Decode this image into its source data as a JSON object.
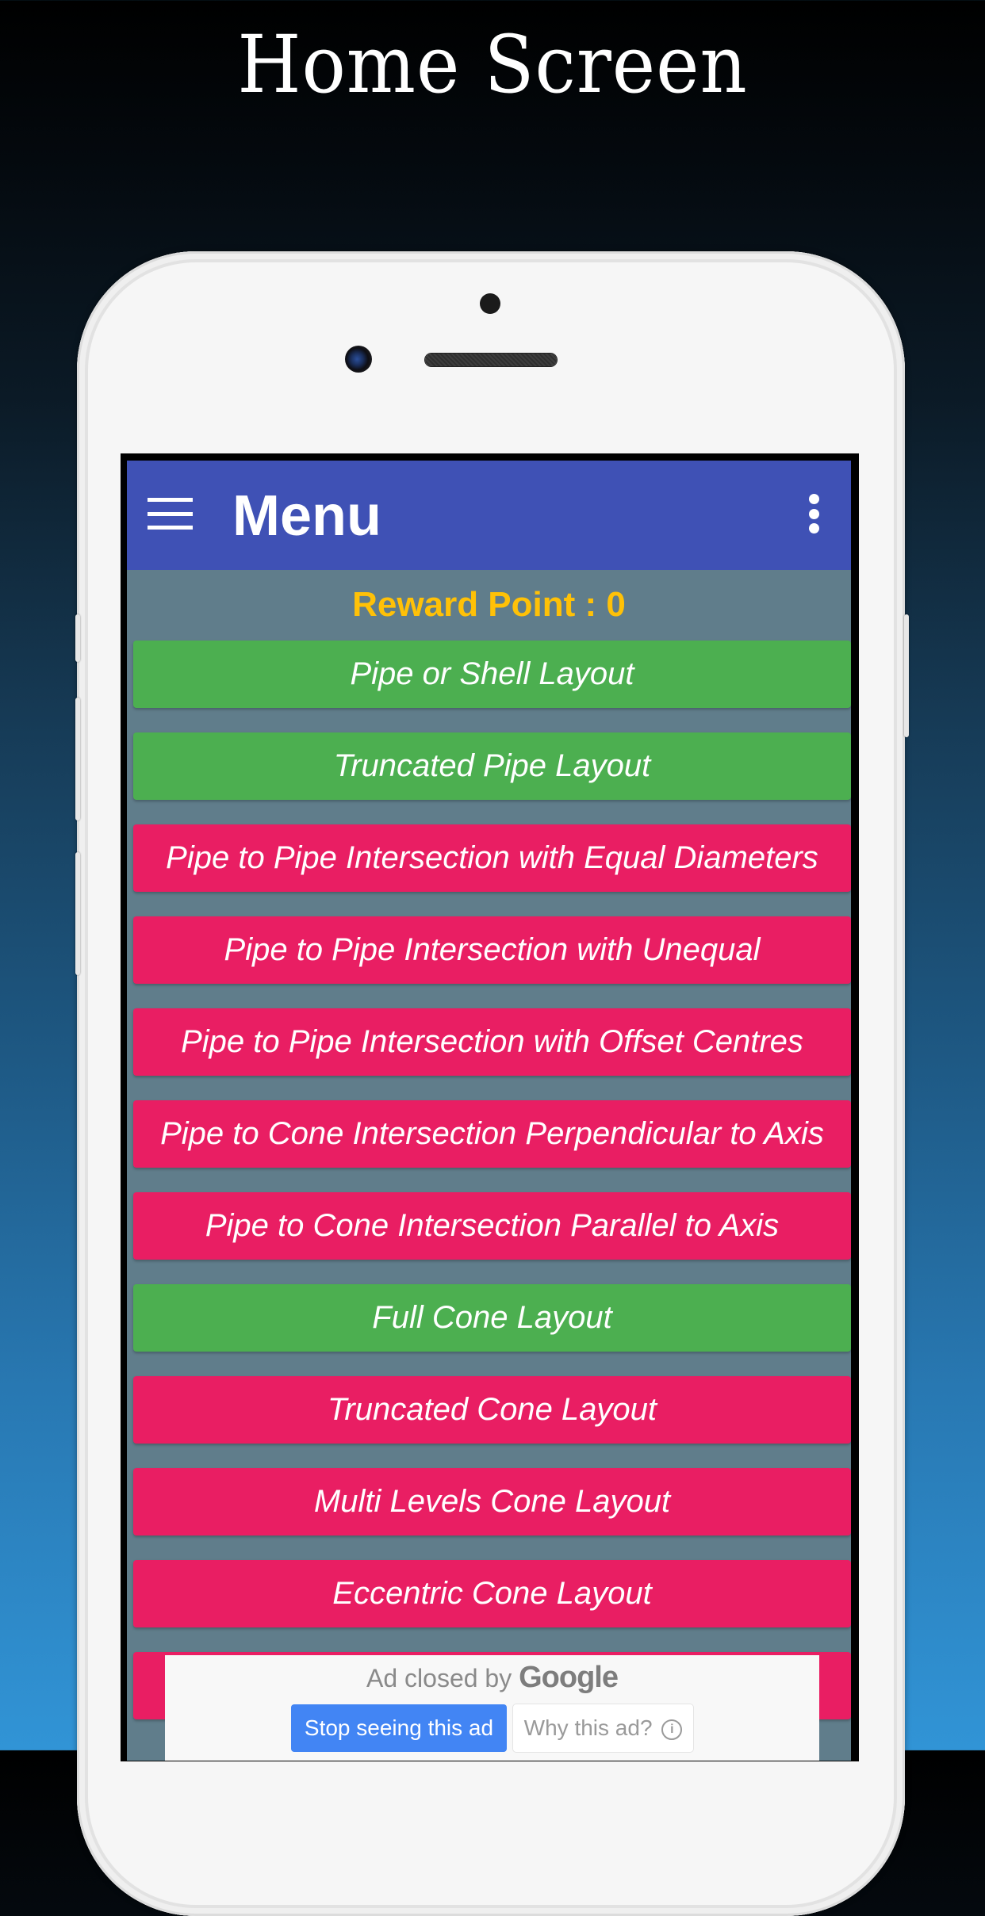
{
  "headline": "Home Screen",
  "app": {
    "toolbar": {
      "title": "Menu",
      "nav_icon": "hamburger-menu-icon",
      "overflow_icon": "more-vertical-icon"
    },
    "reward": "Reward Point : 0",
    "menu_items": [
      {
        "label": "Pipe or Shell Layout",
        "color": "#4caf50"
      },
      {
        "label": "Truncated Pipe Layout",
        "color": "#4caf50"
      },
      {
        "label": "Pipe to Pipe Intersection with Equal Diameters",
        "color": "#e91e63"
      },
      {
        "label": "Pipe to Pipe Intersection with Unequal",
        "color": "#e91e63"
      },
      {
        "label": "Pipe to Pipe Intersection with Offset Centres",
        "color": "#e91e63"
      },
      {
        "label": "Pipe to Cone Intersection Perpendicular to Axis",
        "color": "#e91e63"
      },
      {
        "label": "Pipe to Cone Intersection Parallel to Axis",
        "color": "#e91e63"
      },
      {
        "label": "Full Cone Layout",
        "color": "#4caf50"
      },
      {
        "label": "Truncated Cone Layout",
        "color": "#e91e63"
      },
      {
        "label": "Multi Levels Cone Layout",
        "color": "#e91e63"
      },
      {
        "label": "Eccentric Cone Layout",
        "color": "#e91e63"
      },
      {
        "label": "",
        "color": "#e91e63"
      }
    ],
    "ad": {
      "closed_text": "Ad closed by",
      "brand": "Google",
      "stop_button": "Stop seeing this ad",
      "why_button": "Why this ad?",
      "info_glyph": "i"
    }
  },
  "colors": {
    "toolbar": "#3f51b5",
    "background": "#607d8b",
    "reward_text": "#ffc107",
    "green_button": "#4caf50",
    "pink_button": "#e91e63",
    "ad_blue": "#4285f4"
  }
}
